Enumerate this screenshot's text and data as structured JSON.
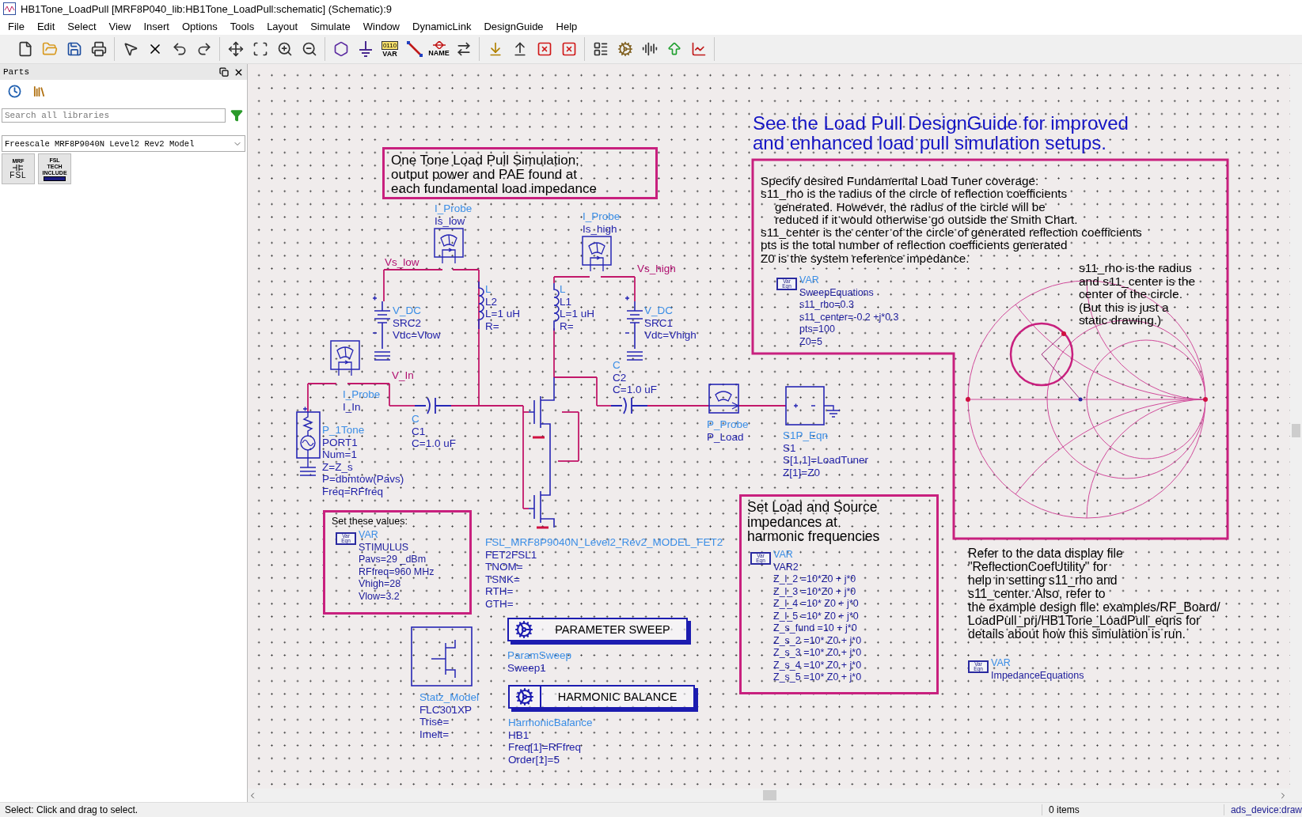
{
  "window": {
    "title": "HB1Tone_LoadPull [MRF8P040_lib:HB1Tone_LoadPull:schematic] (Schematic):9"
  },
  "menu": [
    "File",
    "Edit",
    "Select",
    "View",
    "Insert",
    "Options",
    "Tools",
    "Layout",
    "Simulate",
    "Window",
    "DynamicLink",
    "DesignGuide",
    "Help"
  ],
  "toolbar_groups": [
    {
      "tools": [
        {
          "kind": "new"
        },
        {
          "kind": "open"
        },
        {
          "kind": "save"
        },
        {
          "kind": "print"
        }
      ]
    },
    {
      "tools": [
        {
          "kind": "select"
        },
        {
          "kind": "delete"
        },
        {
          "kind": "undo"
        },
        {
          "kind": "redo"
        }
      ]
    },
    {
      "tools": [
        {
          "kind": "move"
        },
        {
          "kind": "zoom-area"
        },
        {
          "kind": "zoom-in"
        },
        {
          "kind": "zoom-out"
        }
      ]
    },
    {
      "tools": [
        {
          "kind": "port"
        },
        {
          "kind": "ground"
        },
        {
          "kind": "var",
          "code": "0110",
          "label": "VAR"
        },
        {
          "kind": "wire"
        },
        {
          "kind": "name",
          "label": "NAME"
        },
        {
          "kind": "pin"
        }
      ]
    },
    {
      "tools": [
        {
          "kind": "push-down"
        },
        {
          "kind": "pop-up"
        },
        {
          "kind": "deactivate"
        },
        {
          "kind": "short"
        }
      ]
    },
    {
      "tools": [
        {
          "kind": "components"
        },
        {
          "kind": "gear"
        },
        {
          "kind": "tune"
        },
        {
          "kind": "up"
        },
        {
          "kind": "chart"
        }
      ]
    }
  ],
  "parts_panel": {
    "title": "Parts",
    "search": {
      "placeholder": "Search all libraries"
    },
    "library": "Freescale MRF8P9040N Level2 Rev2 Model",
    "tiles": [
      {
        "kind": "device",
        "lines": [
          "MRF",
          "FSL"
        ]
      },
      {
        "kind": "include",
        "lines": [
          "FSL",
          "TECH",
          "INCLUDE"
        ]
      }
    ]
  },
  "schematic": {
    "notes": [
      {
        "kind": "boxed",
        "lines": [
          "One Tone Load Pull Simulation;",
          "output power and PAE found at",
          "each fundamental load impedance"
        ]
      },
      {
        "kind": "heading",
        "lines": [
          "See the Load Pull DesignGuide for improved",
          "and enhanced load pull simulation setups."
        ]
      },
      {
        "kind": "plain",
        "lines": [
          {
            "text": "Specify desired Fundamental Load Tuner coverage:",
            "indent": false
          },
          {
            "text": "s11_rho is the radius of the circle of reflection coefficients",
            "indent": false
          },
          {
            "text": "generated.  However, the radius of the circle will be",
            "indent": true
          },
          {
            "text": "reduced if it would otherwise go outside the Smith Chart.",
            "indent": true
          },
          {
            "text": "s11_center is the center of the circle of generated reflection coefficients",
            "indent": false
          },
          {
            "text": "pts is the total number of reflection coefficients generated",
            "indent": false
          },
          {
            "text": "Z0 is the system reference impedance.",
            "indent": false
          }
        ]
      },
      {
        "kind": "plain",
        "lines": [
          "s11_rho is the radius",
          "and s11_center is the",
          "center of the circle.",
          "(But this is just a",
          "static drawing.)"
        ]
      },
      {
        "kind": "boxed",
        "lines": [
          "Set these values:"
        ]
      },
      {
        "kind": "boxed",
        "lines": [
          "Set Load and Source",
          "impedances at",
          "harmonic frequencies"
        ]
      },
      {
        "kind": "plain",
        "lines": [
          "Refer to the data display file",
          "\"ReflectionCoefUtility\" for",
          "help in setting s11_rho and",
          "s11_center.  Also, refer to",
          "the example design file: examples/RF_Board/",
          "LoadPull_prj/HB1Tone_LoadPull_eqns for",
          "details about how this simulation is run."
        ]
      }
    ],
    "components": [
      {
        "lines": [
          "I_Probe",
          "Is_low"
        ]
      },
      {
        "lines": [
          "I_Probe",
          "Is_high"
        ]
      },
      {
        "lines": [
          "V_DC",
          "SRC2",
          "Vdc=Vlow"
        ]
      },
      {
        "lines": [
          "L",
          "L2",
          "L=1 uH",
          "R="
        ]
      },
      {
        "lines": [
          "L",
          "L1",
          "L=1 uH",
          "R="
        ]
      },
      {
        "lines": [
          "V_DC",
          "SRC1",
          "Vdc=Vhigh"
        ]
      },
      {
        "lines": [
          "C",
          "C2",
          "C=1.0 uF"
        ]
      },
      {
        "lines": [
          "I_Probe",
          "I_In"
        ]
      },
      {
        "lines": [
          "C",
          "C1",
          "C=1.0 uF"
        ]
      },
      {
        "lines": [
          "P_1Tone",
          "PORT1",
          "Num=1",
          "Z=Z_s",
          "P=dbmtow(Pavs)",
          "Freq=RFfreq"
        ]
      },
      {
        "lines": [
          "P_Probe",
          "P_Load"
        ]
      },
      {
        "lines": [
          "S1P_Eqn",
          "S1",
          "S[1,1]=LoadTuner",
          "Z[1]=Z0"
        ]
      },
      {
        "lines": [
          "FSL_MRF8P9040N_Level2_Rev2_MODEL_FET2",
          "FET2FSL1",
          "TNOM=",
          "TSNK=",
          "RTH=",
          "CTH="
        ]
      },
      {
        "lines": [
          "Statz_Model",
          "FLC301XP",
          "Trise=",
          "Imelt="
        ]
      }
    ],
    "var_blocks": [
      {
        "badge": [
          "Var",
          "Eqn"
        ],
        "lines": [
          "VAR",
          "SweepEquations",
          "s11_rho=0.3",
          "s11_center=-0.2 +j*0.3",
          "pts=100",
          "Z0=5"
        ]
      },
      {
        "badge": [
          "Var",
          "Eqn"
        ],
        "lines": [
          "VAR",
          "STIMULUS",
          "Pavs=29 _dBm",
          "RFfreq=960 MHz",
          "Vhigh=28",
          "Vlow=3.2"
        ]
      },
      {
        "badge": [
          "Var",
          "Eqn"
        ],
        "lines": [
          "VAR",
          "VAR2",
          "Z_l_2 =10*Z0 + j*0",
          "Z_l_3 =10*Z0 + j*0",
          "Z_l_4 =10* Z0 + j*0",
          "Z_l_5 =10* Z0 + j*0",
          "Z_s_fund =10 + j*0",
          "Z_s_2 =10* Z0 + j*0",
          "Z_s_3 =10* Z0 + j*0",
          "Z_s_4 =10* Z0 + j*0",
          "Z_s_5 =10* Z0 + j*0"
        ]
      },
      {
        "badge": [
          "Var",
          "Eqn"
        ],
        "lines": [
          "VAR",
          "ImpedanceEquations"
        ]
      }
    ],
    "wire_labels": [
      "Vs_low",
      "Vs_high",
      "V_In"
    ],
    "controllers": [
      {
        "title": "PARAMETER SWEEP",
        "lines": [
          "ParamSweep",
          "Sweep1"
        ]
      },
      {
        "title": "HARMONIC BALANCE",
        "lines": [
          "HarmonicBalance",
          "HB1",
          "Freq[1]=RFfreq",
          "Order[1]=5"
        ]
      }
    ]
  },
  "status_bar": {
    "message": "Select: Click and drag to select.",
    "items": "0 items",
    "context": "ads_device:draw"
  }
}
